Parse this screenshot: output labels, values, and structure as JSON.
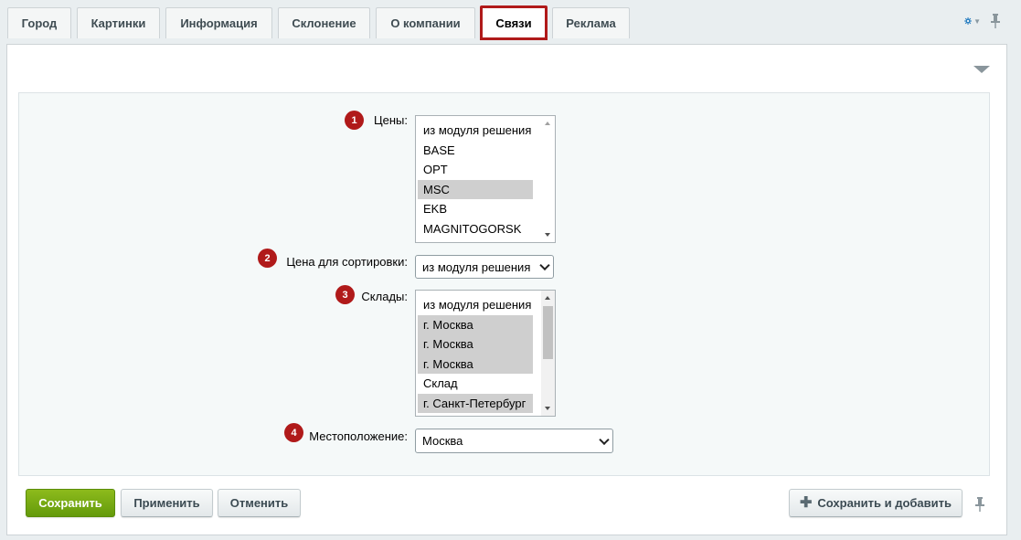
{
  "tabs": [
    {
      "label": "Город"
    },
    {
      "label": "Картинки"
    },
    {
      "label": "Информация"
    },
    {
      "label": "Склонение"
    },
    {
      "label": "О компании"
    },
    {
      "label": "Связи"
    },
    {
      "label": "Реклама"
    }
  ],
  "active_tab": "Связи",
  "form": {
    "prices": {
      "badge": "1",
      "label": "Цены:",
      "options": [
        "из модуля решения",
        "BASE",
        "OPT",
        "MSC",
        "EKB",
        "MAGNITOGORSK"
      ],
      "selected": [
        "MSC"
      ]
    },
    "sort_price": {
      "badge": "2",
      "label": "Цена для сортировки:",
      "value": "из модуля решения"
    },
    "stores": {
      "badge": "3",
      "label": "Склады:",
      "options": [
        "из модуля решения",
        "г. Москва",
        "г. Москва",
        "г. Москва",
        "Склад",
        "г. Санкт-Петербург"
      ],
      "selected_indices": [
        1,
        2,
        3,
        5
      ]
    },
    "location": {
      "badge": "4",
      "label": "Местоположение:",
      "value": "Москва"
    }
  },
  "buttons": {
    "save": "Сохранить",
    "apply": "Применить",
    "cancel": "Отменить",
    "save_and_add": "Сохранить и добавить"
  },
  "colors": {
    "accent_red": "#b01a1a",
    "save_green": "#7aad14",
    "gear_blue": "#2a7fc1"
  }
}
